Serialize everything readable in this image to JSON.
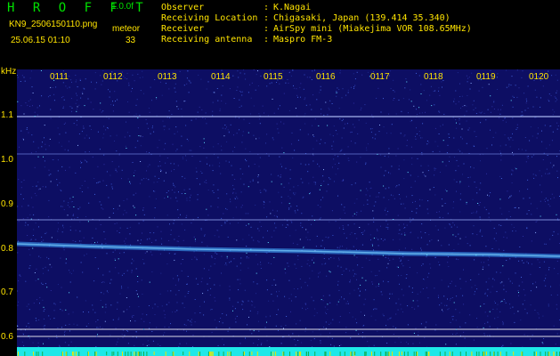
{
  "header": {
    "app_title": "H R O F F T",
    "version": "1.0.0f",
    "file_name": "KN9_2506150110.png",
    "meteor_label": "meteor",
    "timestamp": "25.06.15 01:10",
    "meteor_count": "33"
  },
  "info": {
    "observer_label": "Observer",
    "observer_value": "K.Nagai",
    "location_label": "Receiving Location",
    "location_value": "Chigasaki, Japan (139.414 35.340)",
    "receiver_label": "Receiver",
    "receiver_value": "AirSpy mini (Miakejima VOR 108.65MHz)",
    "antenna_label": "Receiving antenna",
    "antenna_value": "Maspro FM-3",
    "separator": ":"
  },
  "axis": {
    "unit": "kHz",
    "y_ticks": [
      "1.1",
      "1.0",
      "0.9",
      "0.8",
      "0.7",
      "0.6"
    ],
    "time_ticks": [
      "0111",
      "0112",
      "0113",
      "0114",
      "0115",
      "0116",
      "0117",
      "0118",
      "0119",
      "0120"
    ]
  },
  "colors": {
    "background": "#0d0e63",
    "signal": "#b8c8ff",
    "trace": "#40a8ff",
    "text": "#ffe400",
    "title": "#00e000",
    "bar": "#1ee8e8"
  }
}
